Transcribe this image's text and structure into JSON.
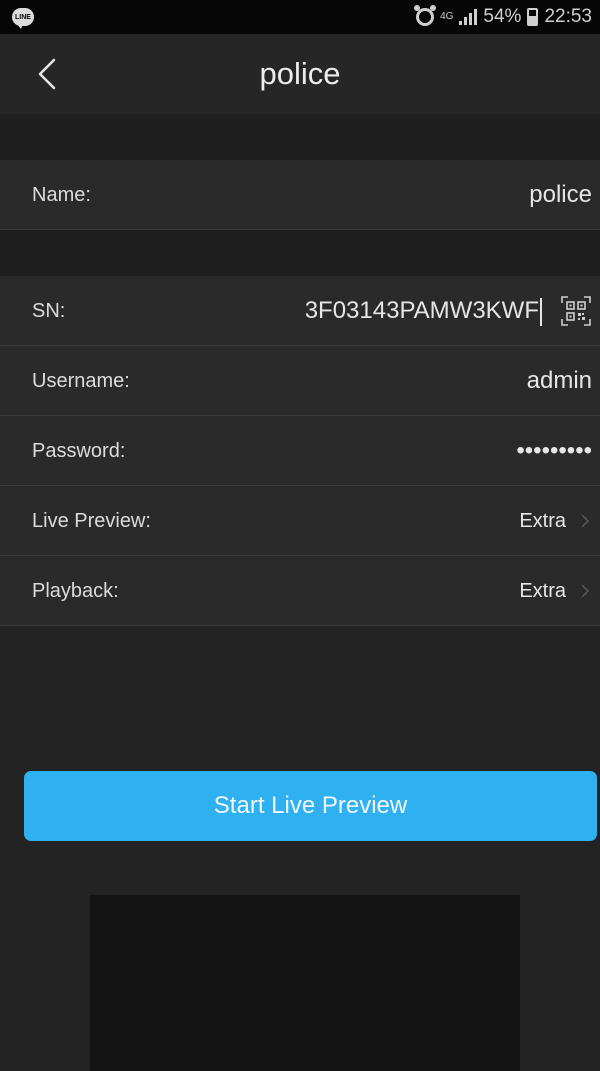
{
  "status_bar": {
    "app_icon": "line-icon",
    "app_icon_text": "LINE",
    "network": "4G",
    "battery_percent": "54%",
    "time": "22:53"
  },
  "header": {
    "title": "police",
    "back_icon": "back-chevron-icon"
  },
  "form": {
    "name": {
      "label": "Name:",
      "value": "police"
    },
    "sn": {
      "label": "SN:",
      "value": "3F03143PAMW3KWF",
      "scan_icon": "qr-code-icon"
    },
    "username": {
      "label": "Username:",
      "value": "admin"
    },
    "password": {
      "label": "Password:",
      "value": "•••••••••"
    },
    "live_preview": {
      "label": "Live Preview:",
      "value": "Extra"
    },
    "playback": {
      "label": "Playback:",
      "value": "Extra"
    }
  },
  "actions": {
    "start_label": "Start Live Preview"
  },
  "colors": {
    "accent": "#2fb0f0",
    "background": "#232323",
    "row_background": "#2a2a2a"
  }
}
